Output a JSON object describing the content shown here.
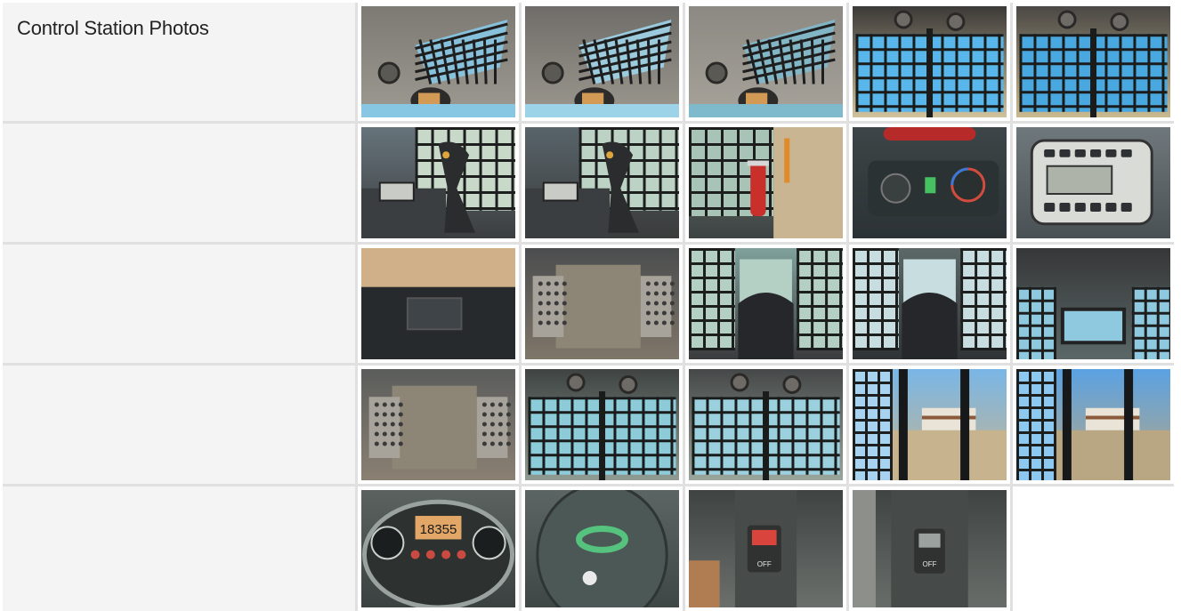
{
  "section": {
    "title": "Control Station Photos"
  },
  "rows": [
    {
      "photos": [
        {
          "name": "cab-ceiling-front-photo",
          "kind": "ceiling",
          "colors": {
            "top": "#7d7a73",
            "bottom": "#9d9a92",
            "glass": "#87c7e4"
          }
        },
        {
          "name": "cab-ceiling-left-photo",
          "kind": "ceiling",
          "colors": {
            "top": "#6f6d69",
            "bottom": "#9c988f",
            "glass": "#9dd3e8"
          }
        },
        {
          "name": "cab-ceiling-center-photo",
          "kind": "ceiling",
          "colors": {
            "top": "#8c8982",
            "bottom": "#a7a39b",
            "glass": "#7fb9cc"
          }
        },
        {
          "name": "rear-window-grille-photo",
          "kind": "grille",
          "colors": {
            "top": "#3c3a38",
            "bottom": "#cfc29c",
            "glass": "#58b6ea"
          }
        },
        {
          "name": "rear-window-grille-wide-photo",
          "kind": "grille",
          "colors": {
            "top": "#4a4845",
            "bottom": "#c9b98f",
            "glass": "#4aa8e0"
          }
        }
      ]
    },
    {
      "photos": [
        {
          "name": "joystick-right-photo",
          "kind": "joystick",
          "colors": {
            "top": "#66737a",
            "bottom": "#3b3e40",
            "glass": "#c8d8c9"
          }
        },
        {
          "name": "joystick-left-photo",
          "kind": "joystick",
          "colors": {
            "top": "#58646a",
            "bottom": "#3a3b3b",
            "glass": "#bcd2c4"
          }
        },
        {
          "name": "fire-extinguisher-photo",
          "kind": "extinguisher",
          "colors": {
            "top": "#6b7874",
            "bottom": "#3d4342",
            "glass": "#a7c4b6"
          }
        },
        {
          "name": "climate-controls-photo",
          "kind": "controls",
          "colors": {
            "top": "#3c4547",
            "bottom": "#2c3235",
            "glass": "#5a6a6d"
          }
        },
        {
          "name": "radio-panel-photo",
          "kind": "radio",
          "colors": {
            "top": "#6f787c",
            "bottom": "#4a5154",
            "glass": "#aeb6b4"
          }
        }
      ]
    },
    {
      "photos": [
        {
          "name": "front-floor-view-photo",
          "kind": "floor",
          "colors": {
            "top": "#c8a677",
            "bottom": "#2e3134",
            "glass": "#d8b98c"
          }
        },
        {
          "name": "floor-pedals-photo",
          "kind": "pedals",
          "colors": {
            "top": "#4b4d4e",
            "bottom": "#7f766a",
            "glass": "#8e8779"
          }
        },
        {
          "name": "operator-seat-photo",
          "kind": "seat",
          "colors": {
            "top": "#7fa19c",
            "bottom": "#3a3b3d",
            "glass": "#b4cfc3"
          }
        },
        {
          "name": "seat-rear-view-photo",
          "kind": "seat",
          "colors": {
            "top": "#5c6868",
            "bottom": "#2f3335",
            "glass": "#c8dde0"
          }
        },
        {
          "name": "cab-interior-rear-photo",
          "kind": "interior",
          "colors": {
            "top": "#363738",
            "bottom": "#5b6767",
            "glass": "#8fc9e0"
          }
        }
      ]
    },
    {
      "photos": [
        {
          "name": "floor-closeup-photo",
          "kind": "pedals",
          "colors": {
            "top": "#5b5d5c",
            "bottom": "#8a8072",
            "glass": "#a59c8d"
          }
        },
        {
          "name": "side-window-grille-photo",
          "kind": "grille",
          "colors": {
            "top": "#3f4443",
            "bottom": "#8f9b92",
            "glass": "#8ccbd9"
          }
        },
        {
          "name": "side-window-grille-right-photo",
          "kind": "grille",
          "colors": {
            "top": "#454848",
            "bottom": "#9aa59b",
            "glass": "#9bd0de"
          }
        },
        {
          "name": "open-door-exterior-photo",
          "kind": "exterior",
          "colors": {
            "top": "#79b6e6",
            "bottom": "#c7b48e",
            "glass": "#a7d3f0"
          }
        },
        {
          "name": "open-door-side-photo",
          "kind": "exterior",
          "colors": {
            "top": "#5aa2e3",
            "bottom": "#b9a783",
            "glass": "#8cc8ef"
          }
        }
      ]
    },
    {
      "photos": [
        {
          "name": "instrument-cluster-photo",
          "kind": "gauge",
          "colors": {
            "top": "#5b625f",
            "bottom": "#3b4140",
            "glass": "#e2a766"
          },
          "display": "18355"
        },
        {
          "name": "traction-lock-override-photo",
          "kind": "switchpanel",
          "colors": {
            "top": "#5b6563",
            "bottom": "#3f4746",
            "glass": "#55c27d"
          }
        },
        {
          "name": "parking-brake-switch-photo",
          "kind": "brake",
          "colors": {
            "top": "#3f4443",
            "bottom": "#6b6f6c",
            "glass": "#d9443c"
          }
        },
        {
          "name": "switch-off-panel-photo",
          "kind": "switchoff",
          "colors": {
            "top": "#3f4443",
            "bottom": "#696d6a",
            "glass": "#9aa19e"
          }
        }
      ]
    }
  ]
}
